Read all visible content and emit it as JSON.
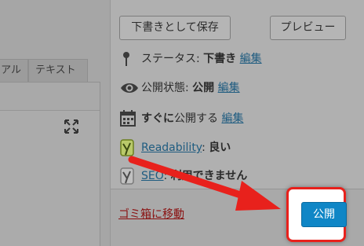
{
  "editor": {
    "tabs": [
      {
        "label": "アル"
      },
      {
        "label": "テキスト"
      }
    ]
  },
  "publish_box": {
    "save_draft_label": "下書きとして保存",
    "preview_label": "プレビュー",
    "status": {
      "prefix": "ステータス: ",
      "value": "下書き",
      "edit_label": "編集"
    },
    "visibility": {
      "prefix": "公開状態: ",
      "value": "公開",
      "edit_label": "編集"
    },
    "schedule": {
      "value": "すぐに",
      "suffix": "公開する",
      "edit_label": "編集"
    },
    "readability": {
      "link_label": "Readability",
      "separator": ": ",
      "value": "良い"
    },
    "seo": {
      "link_label": "SEO",
      "separator": ": ",
      "value": "利用できません"
    },
    "trash_label": "ゴミ箱に移動",
    "publish_label": "公開"
  },
  "colors": {
    "accent_blue": "#0f86c6",
    "highlight_red": "#e8211c",
    "arrow_red": "#e8211c",
    "trash_red": "#8a1010",
    "link_blue": "#1f5c80"
  },
  "icons": {
    "status": "pin-icon",
    "visibility": "eye-icon",
    "schedule": "calendar-icon",
    "readability": "yoast-icon",
    "seo": "yoast-icon",
    "fullscreen": "fullscreen-icon"
  }
}
